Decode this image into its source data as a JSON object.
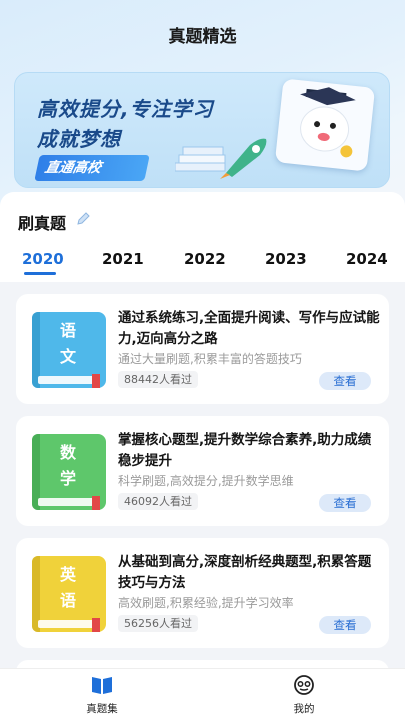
{
  "header": {
    "title": "真题精选"
  },
  "banner": {
    "line1": "高效提分,专注学习",
    "line2": "成就梦想",
    "tag": "直通高校",
    "colors": {
      "accent": "#2f7fe8",
      "text": "#1a4a8a"
    }
  },
  "section": {
    "title": "刷真题"
  },
  "tabs": [
    {
      "label": "2020",
      "active": true
    },
    {
      "label": "2021",
      "active": false
    },
    {
      "label": "2022",
      "active": false
    },
    {
      "label": "2023",
      "active": false
    },
    {
      "label": "2024",
      "active": false
    }
  ],
  "cards": [
    {
      "book_label": "语文",
      "book_color": "#4fb8ea",
      "title": "通过系统练习,全面提升阅读、写作与应试能力,迈向高分之路",
      "subtitle": "通过大量刷题,积累丰富的答题技巧",
      "views": "88442人看过",
      "button": "查看"
    },
    {
      "book_label": "数学",
      "book_color": "#5ec76b",
      "title": "掌握核心题型,提升数学综合素养,助力成绩稳步提升",
      "subtitle": "科学刷题,高效提分,提升数学思维",
      "views": "46092人看过",
      "button": "查看"
    },
    {
      "book_label": "英语",
      "book_color": "#f0d23a",
      "title": "从基础到高分,深度剖析经典题型,积累答题技巧与方法",
      "subtitle": "高效刷题,积累经验,提升学习效率",
      "views": "56256人看过",
      "button": "查看"
    }
  ],
  "bottom_nav": [
    {
      "label": "真题集",
      "icon": "book-icon",
      "active": true
    },
    {
      "label": "我的",
      "icon": "face-icon",
      "active": false
    }
  ],
  "colors": {
    "primary": "#1e6fd9",
    "button_bg": "#dde9f9"
  }
}
